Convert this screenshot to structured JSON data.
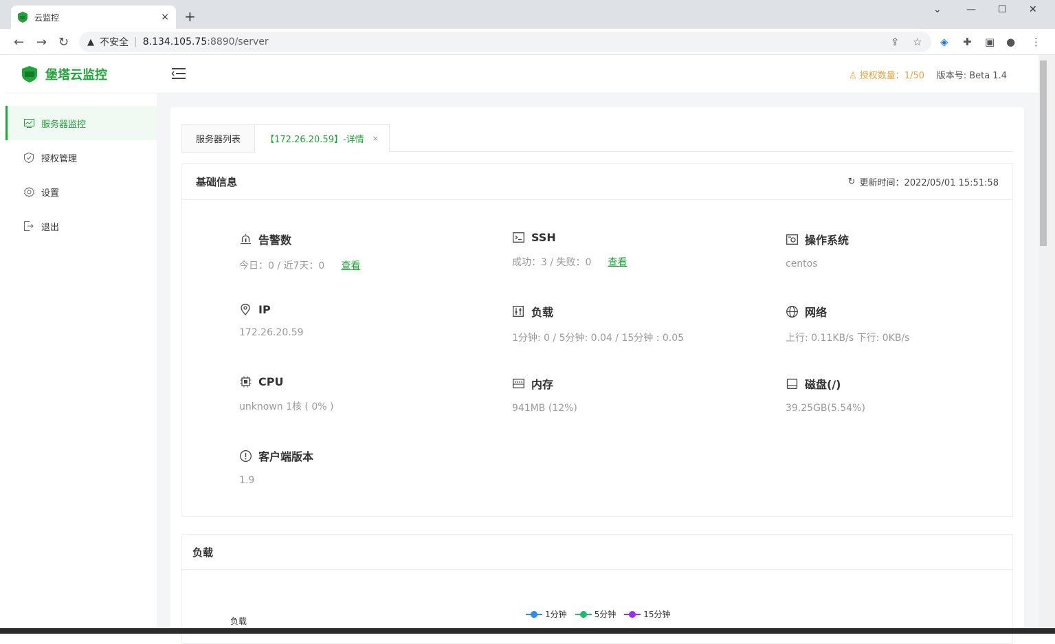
{
  "browser": {
    "tab_title": "云监控",
    "tab_close": "×",
    "new_tab": "+",
    "insecure_label": "不安全",
    "url_host": "8.134.105.75",
    "url_path": ":8890/server"
  },
  "app": {
    "brand": "堡塔云监控",
    "license_label": "授权数量：1/50",
    "version_label": "版本号: Beta 1.4",
    "accent": "#20a53a"
  },
  "sidebar": {
    "items": [
      {
        "label": "服务器监控",
        "icon": "monitor-icon"
      },
      {
        "label": "授权管理",
        "icon": "shield-check-icon"
      },
      {
        "label": "设置",
        "icon": "gear-icon"
      },
      {
        "label": "退出",
        "icon": "logout-icon"
      }
    ]
  },
  "tabs": [
    {
      "label": "服务器列表"
    },
    {
      "label": "【172.26.20.59】-详情",
      "close": "×"
    }
  ],
  "basic_info": {
    "title": "基础信息",
    "update_time": "更新时间：2022/05/01 15:51:58",
    "alarm": {
      "title": "告警数",
      "value": "今日：0  /  近7天：0",
      "link": "查看"
    },
    "ssh": {
      "title": "SSH",
      "value": "成功：3  /   失败：0",
      "link": "查看"
    },
    "os": {
      "title": "操作系统",
      "value": "centos"
    },
    "ip": {
      "title": "IP",
      "value": "172.26.20.59"
    },
    "load": {
      "title": "负载",
      "value": "1分钟: 0 / 5分钟: 0.04 / 15分钟 : 0.05"
    },
    "network": {
      "title": "网络",
      "value": "上行:  0.11KB/s  下行:  0KB/s"
    },
    "cpu": {
      "title": "CPU",
      "value": "unknown 1核 ( 0% )"
    },
    "memory": {
      "title": "内存",
      "value": "941MB (12%)"
    },
    "disk": {
      "title": "磁盘(/)",
      "value": "39.25GB(5.54%)"
    },
    "client": {
      "title": "客户端版本",
      "value": "1.9"
    }
  },
  "load_chart": {
    "title": "负载",
    "ylabel": "负载",
    "legend": [
      {
        "name": "1分钟",
        "color": "#2d8cf0"
      },
      {
        "name": "5分钟",
        "color": "#19be6b"
      },
      {
        "name": "15分钟",
        "color": "#9a2ef0"
      }
    ]
  }
}
